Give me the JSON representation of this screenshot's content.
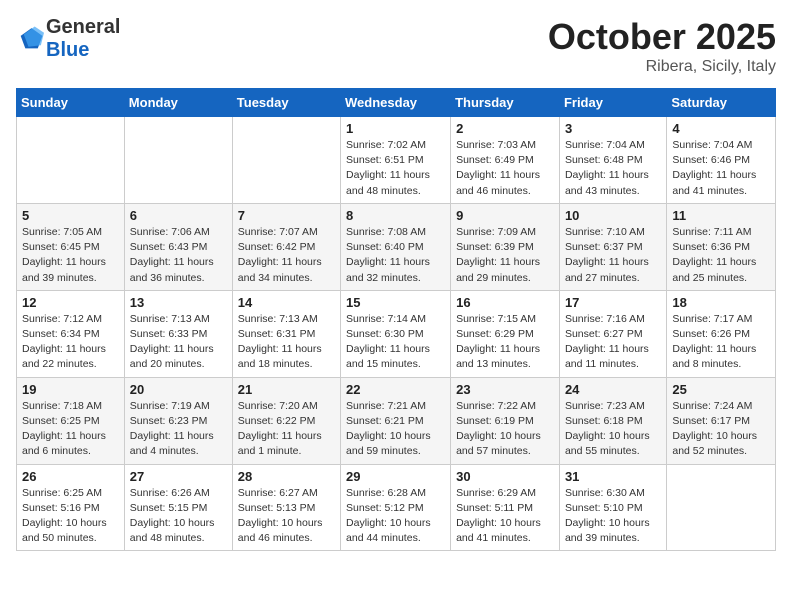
{
  "header": {
    "logo_general": "General",
    "logo_blue": "Blue",
    "month_title": "October 2025",
    "location": "Ribera, Sicily, Italy"
  },
  "weekdays": [
    "Sunday",
    "Monday",
    "Tuesday",
    "Wednesday",
    "Thursday",
    "Friday",
    "Saturday"
  ],
  "weeks": [
    [
      {
        "day": "",
        "info": ""
      },
      {
        "day": "",
        "info": ""
      },
      {
        "day": "",
        "info": ""
      },
      {
        "day": "1",
        "info": "Sunrise: 7:02 AM\nSunset: 6:51 PM\nDaylight: 11 hours\nand 48 minutes."
      },
      {
        "day": "2",
        "info": "Sunrise: 7:03 AM\nSunset: 6:49 PM\nDaylight: 11 hours\nand 46 minutes."
      },
      {
        "day": "3",
        "info": "Sunrise: 7:04 AM\nSunset: 6:48 PM\nDaylight: 11 hours\nand 43 minutes."
      },
      {
        "day": "4",
        "info": "Sunrise: 7:04 AM\nSunset: 6:46 PM\nDaylight: 11 hours\nand 41 minutes."
      }
    ],
    [
      {
        "day": "5",
        "info": "Sunrise: 7:05 AM\nSunset: 6:45 PM\nDaylight: 11 hours\nand 39 minutes."
      },
      {
        "day": "6",
        "info": "Sunrise: 7:06 AM\nSunset: 6:43 PM\nDaylight: 11 hours\nand 36 minutes."
      },
      {
        "day": "7",
        "info": "Sunrise: 7:07 AM\nSunset: 6:42 PM\nDaylight: 11 hours\nand 34 minutes."
      },
      {
        "day": "8",
        "info": "Sunrise: 7:08 AM\nSunset: 6:40 PM\nDaylight: 11 hours\nand 32 minutes."
      },
      {
        "day": "9",
        "info": "Sunrise: 7:09 AM\nSunset: 6:39 PM\nDaylight: 11 hours\nand 29 minutes."
      },
      {
        "day": "10",
        "info": "Sunrise: 7:10 AM\nSunset: 6:37 PM\nDaylight: 11 hours\nand 27 minutes."
      },
      {
        "day": "11",
        "info": "Sunrise: 7:11 AM\nSunset: 6:36 PM\nDaylight: 11 hours\nand 25 minutes."
      }
    ],
    [
      {
        "day": "12",
        "info": "Sunrise: 7:12 AM\nSunset: 6:34 PM\nDaylight: 11 hours\nand 22 minutes."
      },
      {
        "day": "13",
        "info": "Sunrise: 7:13 AM\nSunset: 6:33 PM\nDaylight: 11 hours\nand 20 minutes."
      },
      {
        "day": "14",
        "info": "Sunrise: 7:13 AM\nSunset: 6:31 PM\nDaylight: 11 hours\nand 18 minutes."
      },
      {
        "day": "15",
        "info": "Sunrise: 7:14 AM\nSunset: 6:30 PM\nDaylight: 11 hours\nand 15 minutes."
      },
      {
        "day": "16",
        "info": "Sunrise: 7:15 AM\nSunset: 6:29 PM\nDaylight: 11 hours\nand 13 minutes."
      },
      {
        "day": "17",
        "info": "Sunrise: 7:16 AM\nSunset: 6:27 PM\nDaylight: 11 hours\nand 11 minutes."
      },
      {
        "day": "18",
        "info": "Sunrise: 7:17 AM\nSunset: 6:26 PM\nDaylight: 11 hours\nand 8 minutes."
      }
    ],
    [
      {
        "day": "19",
        "info": "Sunrise: 7:18 AM\nSunset: 6:25 PM\nDaylight: 11 hours\nand 6 minutes."
      },
      {
        "day": "20",
        "info": "Sunrise: 7:19 AM\nSunset: 6:23 PM\nDaylight: 11 hours\nand 4 minutes."
      },
      {
        "day": "21",
        "info": "Sunrise: 7:20 AM\nSunset: 6:22 PM\nDaylight: 11 hours\nand 1 minute."
      },
      {
        "day": "22",
        "info": "Sunrise: 7:21 AM\nSunset: 6:21 PM\nDaylight: 10 hours\nand 59 minutes."
      },
      {
        "day": "23",
        "info": "Sunrise: 7:22 AM\nSunset: 6:19 PM\nDaylight: 10 hours\nand 57 minutes."
      },
      {
        "day": "24",
        "info": "Sunrise: 7:23 AM\nSunset: 6:18 PM\nDaylight: 10 hours\nand 55 minutes."
      },
      {
        "day": "25",
        "info": "Sunrise: 7:24 AM\nSunset: 6:17 PM\nDaylight: 10 hours\nand 52 minutes."
      }
    ],
    [
      {
        "day": "26",
        "info": "Sunrise: 6:25 AM\nSunset: 5:16 PM\nDaylight: 10 hours\nand 50 minutes."
      },
      {
        "day": "27",
        "info": "Sunrise: 6:26 AM\nSunset: 5:15 PM\nDaylight: 10 hours\nand 48 minutes."
      },
      {
        "day": "28",
        "info": "Sunrise: 6:27 AM\nSunset: 5:13 PM\nDaylight: 10 hours\nand 46 minutes."
      },
      {
        "day": "29",
        "info": "Sunrise: 6:28 AM\nSunset: 5:12 PM\nDaylight: 10 hours\nand 44 minutes."
      },
      {
        "day": "30",
        "info": "Sunrise: 6:29 AM\nSunset: 5:11 PM\nDaylight: 10 hours\nand 41 minutes."
      },
      {
        "day": "31",
        "info": "Sunrise: 6:30 AM\nSunset: 5:10 PM\nDaylight: 10 hours\nand 39 minutes."
      },
      {
        "day": "",
        "info": ""
      }
    ]
  ]
}
